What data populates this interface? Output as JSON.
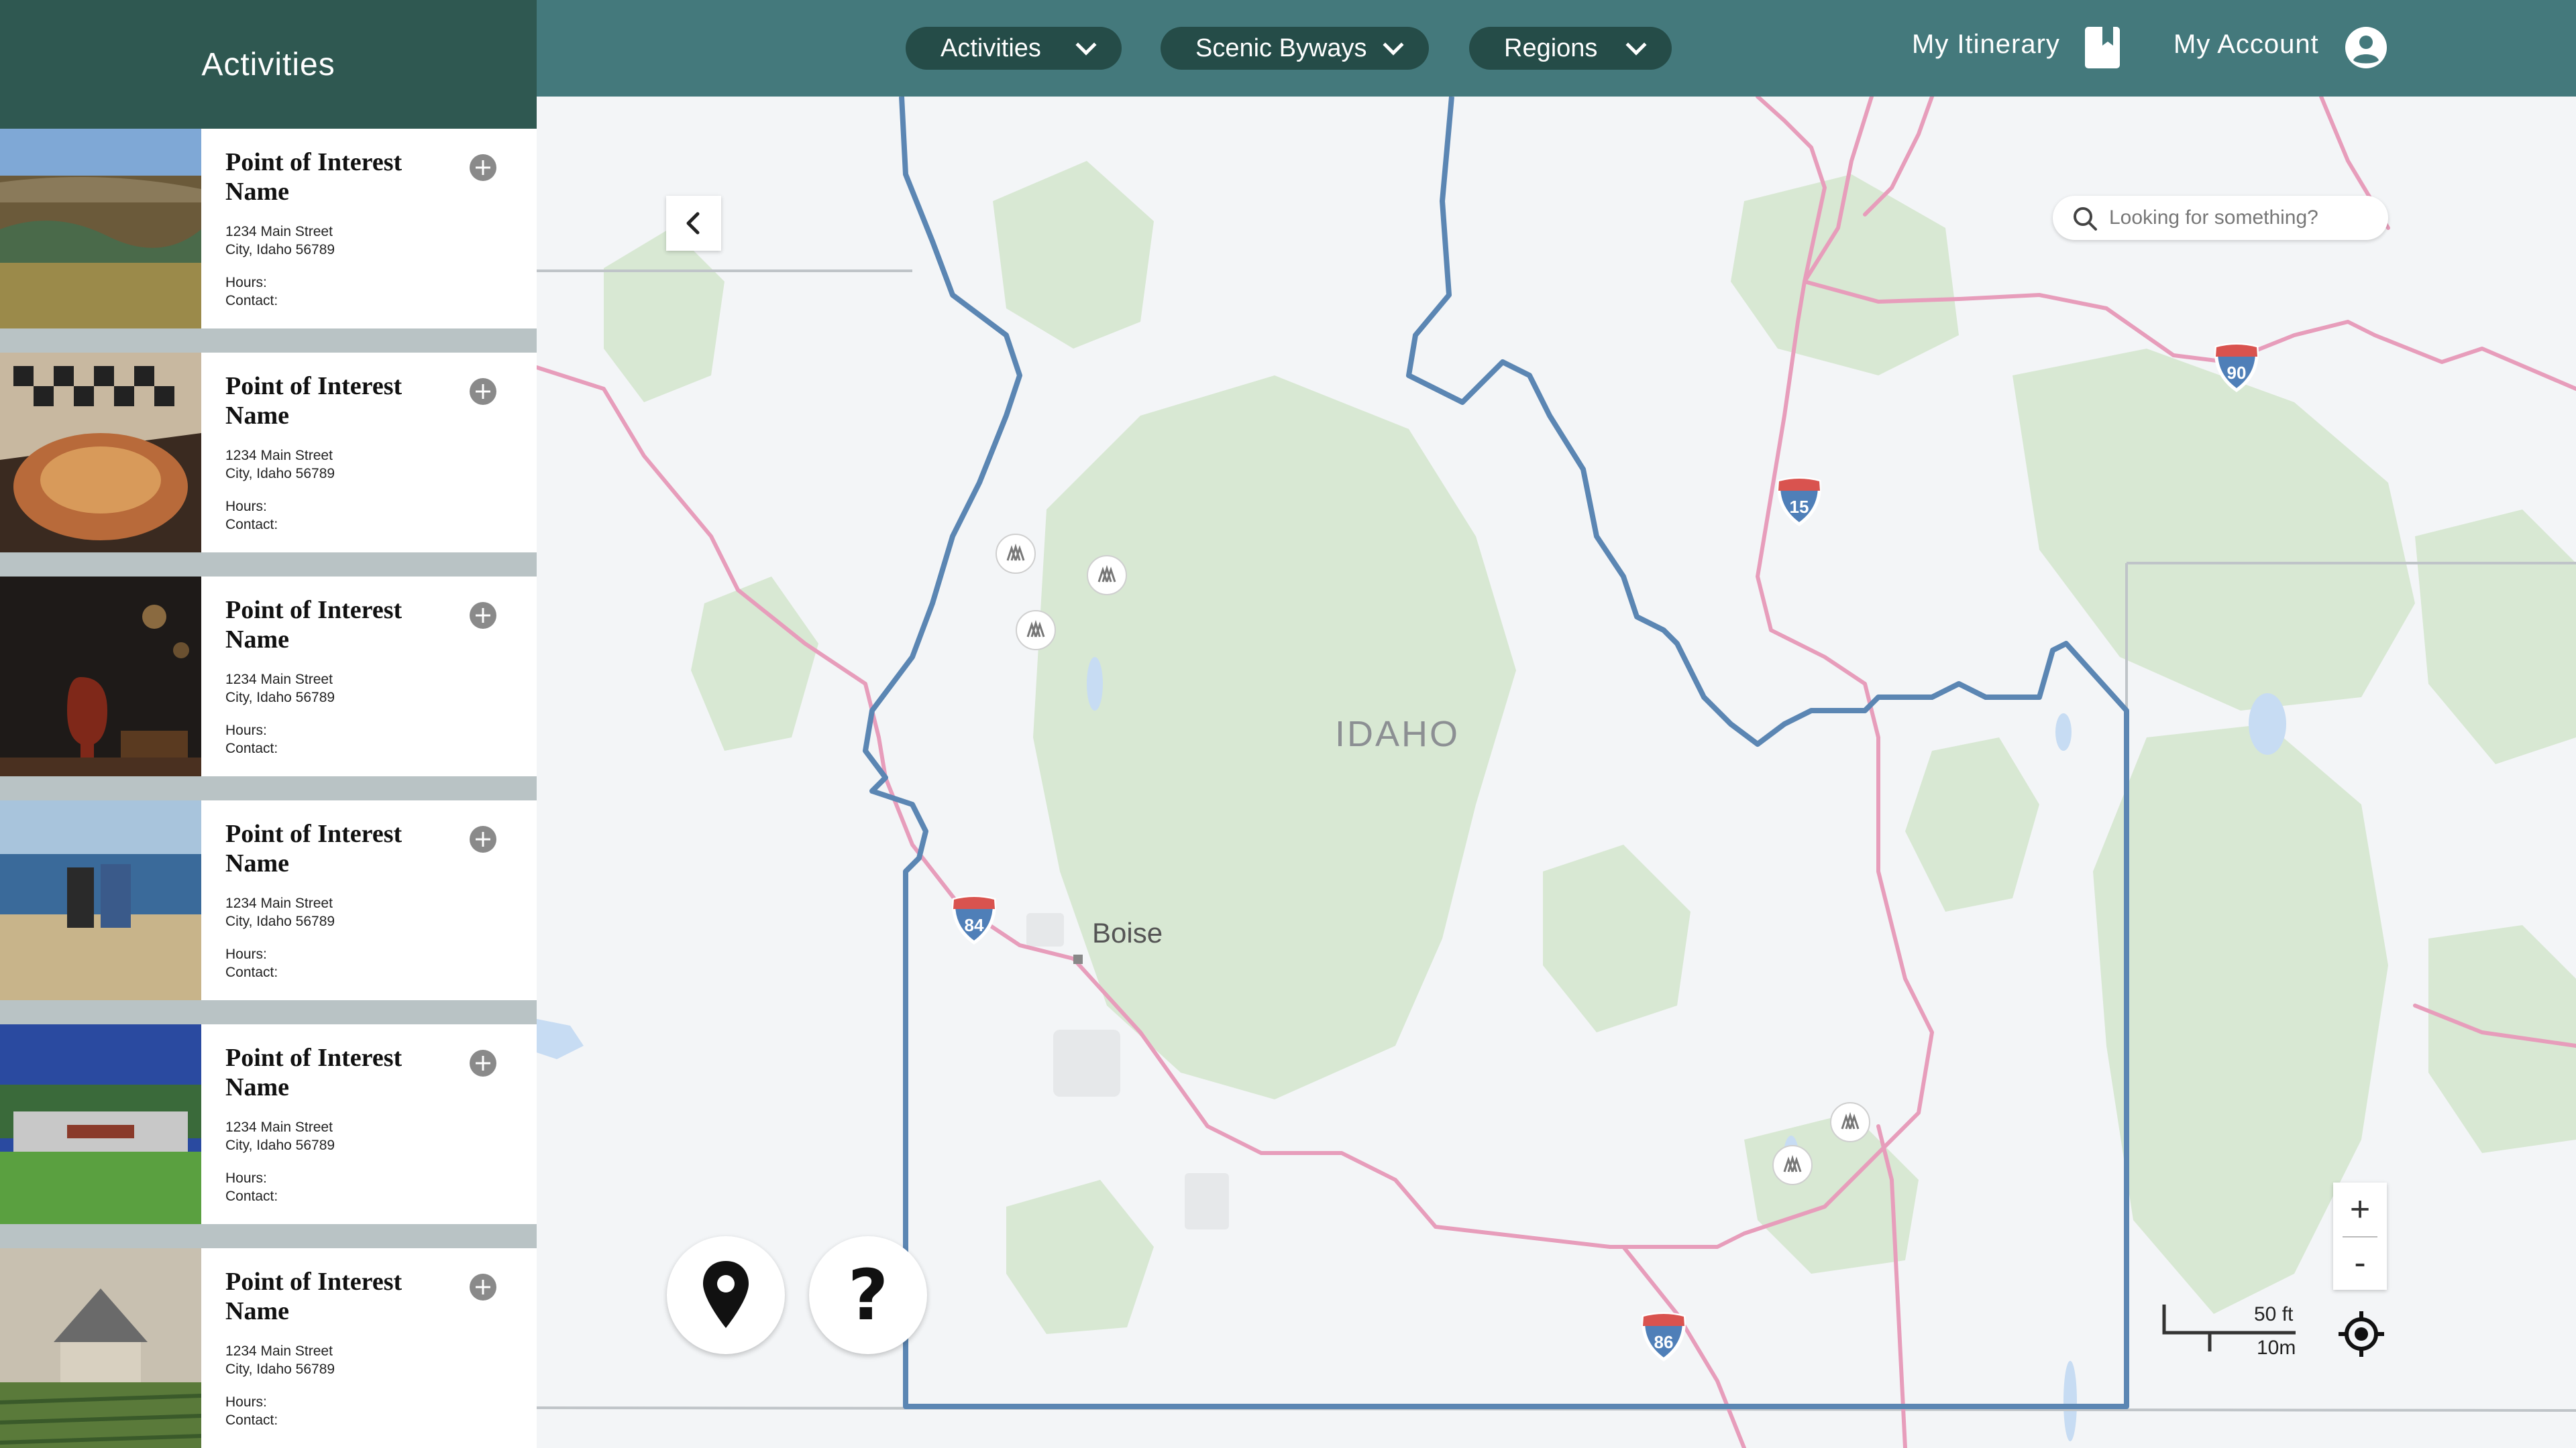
{
  "sidebar": {
    "title": "Activities",
    "cards": [
      {
        "title": "Point of Interest Name",
        "street": "1234 Main Street",
        "city": "City, Idaho 56789",
        "hours": "Hours:",
        "contact": "Contact:"
      },
      {
        "title": "Point of Interest Name",
        "street": "1234 Main Street",
        "city": "City, Idaho 56789",
        "hours": "Hours:",
        "contact": "Contact:"
      },
      {
        "title": "Point of Interest Name",
        "street": "1234 Main Street",
        "city": "City, Idaho 56789",
        "hours": "Hours:",
        "contact": "Contact:"
      },
      {
        "title": "Point of Interest Name",
        "street": "1234 Main Street",
        "city": "City, Idaho 56789",
        "hours": "Hours:",
        "contact": "Contact:"
      },
      {
        "title": "Point of Interest Name",
        "street": "1234 Main Street",
        "city": "City, Idaho 56789",
        "hours": "Hours:",
        "contact": "Contact:"
      },
      {
        "title": "Point of Interest Name",
        "street": "1234 Main Street",
        "city": "City, Idaho 56789",
        "hours": "Hours:",
        "contact": "Contact:"
      }
    ]
  },
  "nav": {
    "menus": [
      {
        "label": "Activities"
      },
      {
        "label": "Scenic Byways"
      },
      {
        "label": "Regions"
      }
    ],
    "itinerary": "My Itinerary",
    "account": "My Account"
  },
  "map": {
    "state_label": "IDAHO",
    "city_label": "Boise",
    "search_placeholder": "Looking for something?",
    "zoom_in": "+",
    "zoom_out": "-",
    "scale_ft": "50 ft",
    "scale_m": "10m",
    "shields": [
      "90",
      "15",
      "84",
      "86"
    ]
  },
  "colors": {
    "header_dark": "#2f5851",
    "topbar": "#44797c",
    "pill": "#254c48",
    "border": "#5b86b3",
    "road": "#e58fb0",
    "forest": "#d6e6d1"
  },
  "icons": [
    "chevron-down-icon",
    "bookmark-icon",
    "user-circle-icon",
    "search-icon",
    "chevron-left-icon",
    "map-pin-icon",
    "question-icon",
    "target-icon",
    "plus-icon",
    "tree-icon"
  ]
}
